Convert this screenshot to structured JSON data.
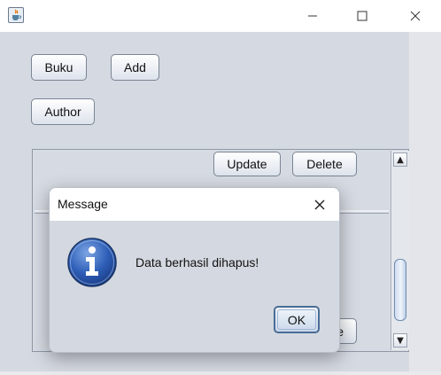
{
  "window": {
    "app_icon": "java-cup-icon",
    "controls": [
      "minimize-icon",
      "maximize-icon",
      "close-icon"
    ]
  },
  "toolbar": {
    "buku_label": "Buku",
    "add_label": "Add",
    "author_label": "Author"
  },
  "table_row": {
    "update_label": "Update",
    "delete_label": "Delete",
    "partial_button_label": "e"
  },
  "scrollbar": {
    "up_arrow": "▲",
    "down_arrow": "▼"
  },
  "dialog": {
    "title": "Message",
    "icon": "information-icon",
    "message": "Data berhasil dihapus!",
    "ok_label": "OK"
  }
}
